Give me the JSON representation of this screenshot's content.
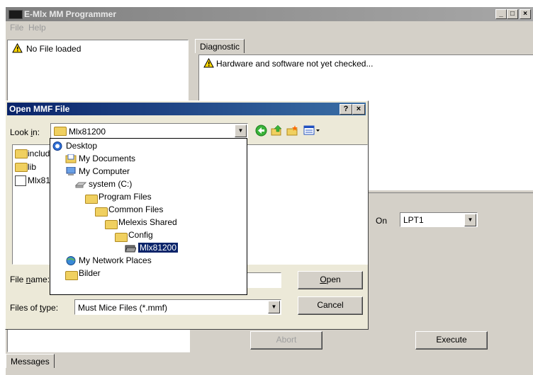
{
  "main": {
    "title": "E-Mlx MM Programmer",
    "menu": [
      "File",
      "Help"
    ],
    "file_status": "No File loaded",
    "tab_diagnostic": "Diagnostic",
    "diagnostic_message": "Hardware and software not yet checked...",
    "port_label": "On",
    "port_value": "LPT1",
    "abort_label": "Abort",
    "execute_label": "Execute",
    "messages_tab": "Messages",
    "title_buttons": [
      "_",
      "□",
      "×"
    ]
  },
  "dialog": {
    "title": "Open MMF File",
    "help_btn": "?",
    "close_btn": "×",
    "lookin_label": "Look in:",
    "lookin_value": "Mlx81200",
    "toolbar_icons": [
      "back-icon",
      "up-folder-icon",
      "new-folder-icon",
      "view-menu-icon"
    ],
    "files": [
      "include",
      "lib",
      "Mlx81"
    ],
    "filename_label": "File name:",
    "filetype_label": "Files of type:",
    "filetype_value": "Must Mice Files (*.mmf)",
    "open_btn": "Open",
    "cancel_btn": "Cancel",
    "dropdown": [
      {
        "label": "Desktop",
        "icon": "desktop-icon",
        "level": 0
      },
      {
        "label": "My Documents",
        "icon": "documents-icon",
        "level": 1
      },
      {
        "label": "My Computer",
        "icon": "computer-icon",
        "level": 1
      },
      {
        "label": "system (C:)",
        "icon": "drive-icon",
        "level": 2
      },
      {
        "label": "Program Files",
        "icon": "folder-icon",
        "level": 3
      },
      {
        "label": "Common Files",
        "icon": "folder-icon",
        "level": 4
      },
      {
        "label": "Melexis Shared",
        "icon": "folder-icon",
        "level": 5
      },
      {
        "label": "Config",
        "icon": "folder-icon",
        "level": 6
      },
      {
        "label": "Mlx81200",
        "icon": "open-folder-icon",
        "level": 7
      },
      {
        "label": "My Network Places",
        "icon": "network-icon",
        "level": 1
      },
      {
        "label": "Bilder",
        "icon": "folder-icon",
        "level": 1
      }
    ]
  },
  "colors": {
    "titlebar_active": "#0a246a",
    "titlebar_inactive": "#808080",
    "face": "#d4d0c8",
    "dialog_face": "#ece9d8",
    "selection": "#0a246a"
  }
}
